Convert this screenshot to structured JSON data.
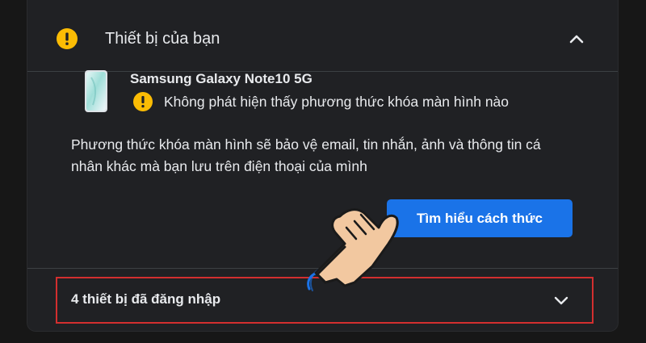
{
  "section": {
    "title": "Thiết bị của bạn",
    "header_icon": "warning-icon",
    "toggle_icon": "chevron-up-icon"
  },
  "device": {
    "name": "Samsung Galaxy Note10 5G",
    "status_icon": "warning-icon",
    "status": "Không phát hiện thấy phương thức khóa màn hình nào"
  },
  "description": "Phương thức khóa màn hình sẽ bảo vệ email, tin nhắn, ảnh và thông tin cá nhân khác mà bạn lưu trên điện thoại của mình",
  "action": {
    "label": "Tìm hiểu cách thức"
  },
  "logged_in": {
    "label": "4 thiết bị đã đăng nhập",
    "toggle_icon": "chevron-down-icon"
  },
  "colors": {
    "background": "#171717",
    "card": "#202124",
    "accent": "#1a73e8",
    "warning": "#fbbc04",
    "highlight_border": "#d32f2f"
  }
}
